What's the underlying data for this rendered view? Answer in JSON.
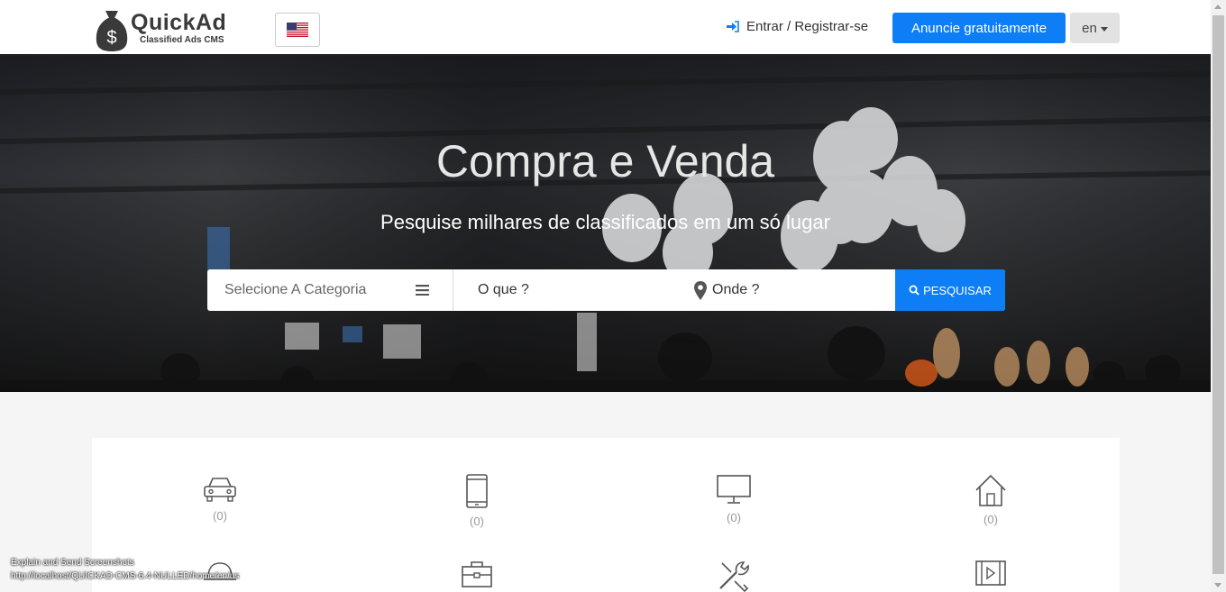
{
  "header": {
    "logo_title": "QuickAd",
    "logo_subtitle": "Classified Ads CMS",
    "login_label": "Entrar / Registrar-se",
    "post_button_label": "Anuncie gratuitamente",
    "lang_label": "en"
  },
  "hero": {
    "title": "Compra e Venda",
    "subtitle": "Pesquise milhares de classificados em um só lugar"
  },
  "search": {
    "category_placeholder": "Selecione A Categoria",
    "what_placeholder": "O que ?",
    "where_placeholder": "Onde ?",
    "button_label": "PESQUISAR"
  },
  "categories": [
    {
      "icon": "car-icon",
      "count": "(0)"
    },
    {
      "icon": "mobile-phone-icon",
      "count": "(0)"
    },
    {
      "icon": "monitor-icon",
      "count": "(0)"
    },
    {
      "icon": "home-icon",
      "count": "(0)"
    },
    {
      "icon": "hat-icon",
      "count": ""
    },
    {
      "icon": "briefcase-icon",
      "count": ""
    },
    {
      "icon": "tools-icon",
      "count": ""
    },
    {
      "icon": "film-icon",
      "count": ""
    }
  ],
  "overlay": {
    "line1": "Explain and Send Screenshots",
    "line2": "http://localhost/QUICKAD-CMS-6.4-NULLED/home/en/us"
  },
  "colors": {
    "accent": "#0d7ef5",
    "header_bg": "#ffffff",
    "lang_bg": "#e2e2e2"
  }
}
